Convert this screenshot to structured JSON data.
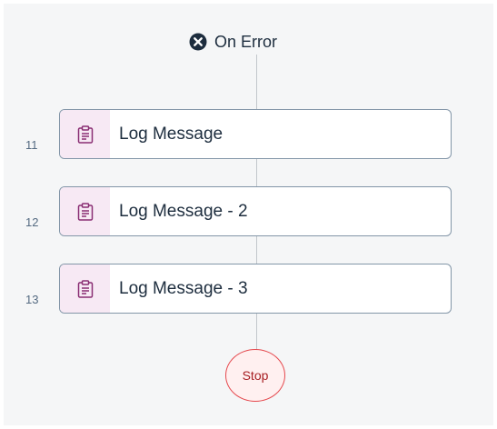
{
  "header": {
    "icon": "close-circle-icon",
    "label": "On Error"
  },
  "steps": [
    {
      "index": "11",
      "label": "Log Message",
      "icon": "clipboard-icon"
    },
    {
      "index": "12",
      "label": "Log Message - 2",
      "icon": "clipboard-icon"
    },
    {
      "index": "13",
      "label": "Log Message - 3",
      "icon": "clipboard-icon"
    }
  ],
  "stop": {
    "label": "Stop"
  },
  "colors": {
    "canvas_background": "#f5f6f7",
    "connector": "#c2c7cc",
    "step_icon_background": "#f7e9f4",
    "step_icon": "#8a2e73",
    "stop_border": "#e5484d",
    "stop_background": "#fff0f0",
    "stop_text": "#a71e22"
  }
}
